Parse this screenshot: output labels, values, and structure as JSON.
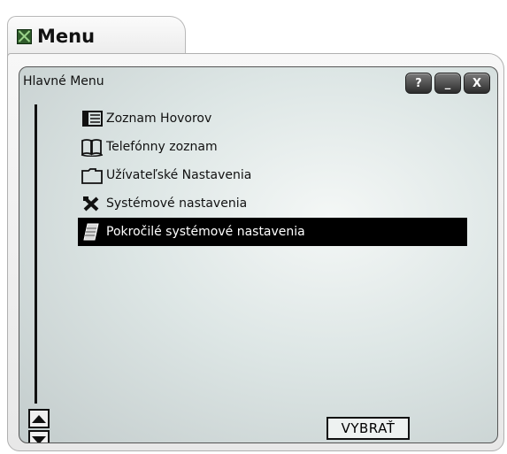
{
  "window": {
    "title": "Menu"
  },
  "panel": {
    "header": "Hlavné Menu",
    "buttons": {
      "help": "?",
      "minimize": "_",
      "close": "X"
    }
  },
  "menu": {
    "items": [
      {
        "label": "Zoznam Hovorov",
        "icon": "call-list-icon"
      },
      {
        "label": "Telefónny zoznam",
        "icon": "phonebook-icon"
      },
      {
        "label": "Užívateľské Nastavenia",
        "icon": "folder-icon"
      },
      {
        "label": "Systémové nastavenia",
        "icon": "tools-icon"
      },
      {
        "label": "Pokročilé systémové nastavenia",
        "icon": "keypad-icon",
        "selected": true
      }
    ]
  },
  "select_button": "VYBRAŤ"
}
